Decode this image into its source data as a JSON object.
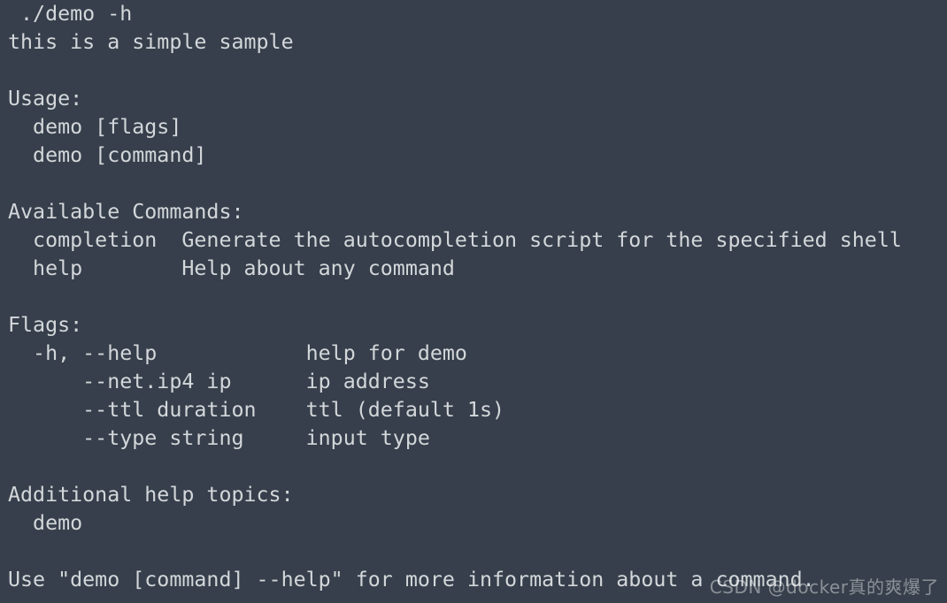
{
  "terminal": {
    "background_color": "#363f4b",
    "text_color": "#d3d7da",
    "command": " ./demo -h",
    "lines": [
      " ./demo -h",
      "this is a simple sample",
      "",
      "Usage:",
      "  demo [flags]",
      "  demo [command]",
      "",
      "Available Commands:",
      "  completion  Generate the autocompletion script for the specified shell",
      "  help        Help about any command",
      "",
      "Flags:",
      "  -h, --help            help for demo",
      "      --net.ip4 ip      ip address",
      "      --ttl duration    ttl (default 1s)",
      "      --type string     input type",
      "",
      "Additional help topics:",
      "  demo",
      "",
      "Use \"demo [command] --help\" for more information about a command."
    ],
    "sections": {
      "intro": "this is a simple sample",
      "usage_heading": "Usage:",
      "usage_items": [
        "demo [flags]",
        "demo [command]"
      ],
      "commands_heading": "Available Commands:",
      "commands": [
        {
          "name": "completion",
          "description": "Generate the autocompletion script for the specified shell"
        },
        {
          "name": "help",
          "description": "Help about any command"
        }
      ],
      "flags_heading": "Flags:",
      "flags": [
        {
          "short": "-h,",
          "long": "--help",
          "arg": "",
          "description": "help for demo"
        },
        {
          "short": "",
          "long": "--net.ip4",
          "arg": "ip",
          "description": "ip address"
        },
        {
          "short": "",
          "long": "--ttl",
          "arg": "duration",
          "description": "ttl (default 1s)"
        },
        {
          "short": "",
          "long": "--type",
          "arg": "string",
          "description": "input type"
        }
      ],
      "help_topics_heading": "Additional help topics:",
      "help_topics": [
        "demo"
      ],
      "footer": "Use \"demo [command] --help\" for more information about a command."
    }
  },
  "watermark": {
    "text": "CSDN @docker真的爽爆了",
    "color": "#ffffff"
  }
}
